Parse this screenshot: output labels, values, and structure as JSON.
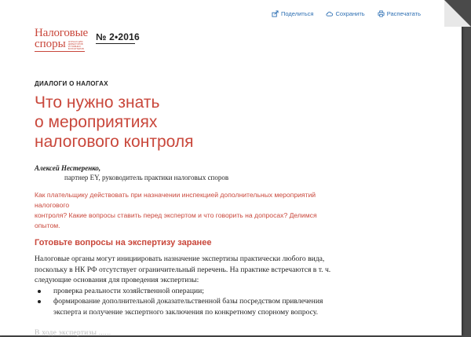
{
  "toolbar": {
    "share_label": "Поделиться",
    "save_label": "Сохранить",
    "print_label": "Распечатать"
  },
  "logo": {
    "line1": "Налоговые",
    "line2": "споры",
    "small_text": "ЖУРНАЛ ДЛЯ ДИРЕКТОРОВ И ГЛАВНЫХ БУХГАЛТЕРОВ"
  },
  "issue": "№ 2•2016",
  "rubric": "ДИАЛОГИ О НАЛОГАХ",
  "title_lines": [
    "Что нужно знать",
    "о мероприятиях",
    "налогового контроля"
  ],
  "author": {
    "name": "Алексей Нестеренко,",
    "role": "партнер EY, руководитель практики налоговых споров"
  },
  "lead_lines": [
    "Как плательщику действовать при назначении инспекцией дополнительных мероприятий налогового",
    "контроля? Какие вопросы ставить перед экспертом и что говорить на допросах? Делимся опытом."
  ],
  "section_title": "Готовьте вопросы на экспертизу заранее",
  "body_lines": [
    "Налоговые органы могут инициировать назначение экспертизы практически любого вида,",
    "поскольку в НК РФ отсутствует ограничительный перечень. На практике встречаются в т. ч.",
    "следующие основания для проведения экспертизы:"
  ],
  "bullets": [
    [
      "проверка реальности хозяйственной операции;"
    ],
    [
      "формирование дополнительной доказательственной базы посредством привлечения",
      "эксперта и получение экспертного заключения по конкретному спорному вопросу."
    ]
  ],
  "faded_text": "В ходе экспертизы ......"
}
